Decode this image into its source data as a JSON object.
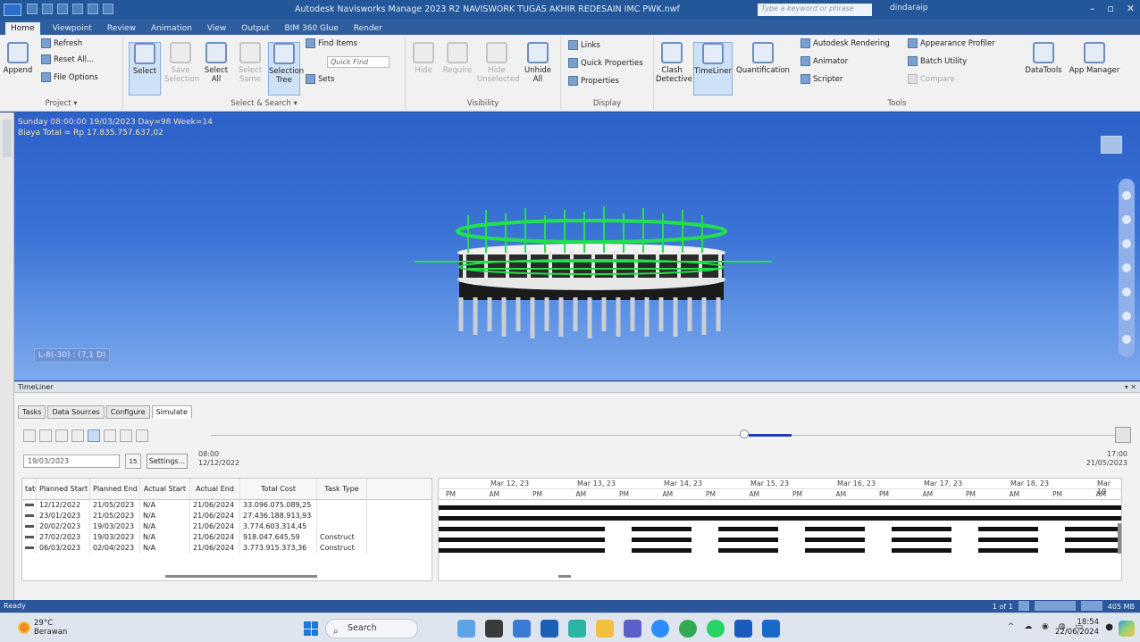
{
  "titlebar": {
    "title": "Autodesk Navisworks Manage 2023   R2 NAVISWORK TUGAS AKHIR REDESAIN IMC PWK.nwf",
    "search_placeholder": "Type a keyword or phrase",
    "user": "dindaraip",
    "accent": "#24579a"
  },
  "tabs": [
    "Home",
    "Viewpoint",
    "Review",
    "Animation",
    "View",
    "Output",
    "BIM 360 Glue",
    "Render"
  ],
  "ribbon": {
    "project": {
      "label": "Project ▾",
      "append": "Append",
      "refresh": "Refresh",
      "reset": "Reset All...",
      "file_options": "File Options"
    },
    "select_search": {
      "label": "Select & Search ▾",
      "select": "Select",
      "save_selection": "Save Selection",
      "select_all": "Select All",
      "select_same": "Select Same",
      "selection_tree": "Selection Tree",
      "find_items": "Find Items",
      "quick_find": "Quick Find",
      "sets": "Sets"
    },
    "visibility": {
      "label": "Visibility",
      "hide": "Hide",
      "require": "Require",
      "hide_unselected": "Hide Unselected",
      "unhide_all": "Unhide All"
    },
    "display": {
      "label": "Display",
      "links": "Links",
      "quick_properties": "Quick Properties",
      "properties": "Properties"
    },
    "tools": {
      "label": "Tools",
      "clash": "Clash Detective",
      "timeliner": "TimeLiner",
      "quantification": "Quantification",
      "autodesk_rendering": "Autodesk Rendering",
      "animator": "Animator",
      "scripter": "Scripter",
      "appearance_profiler": "Appearance Profiler",
      "batch_utility": "Batch Utility",
      "compare": "Compare",
      "datatools": "DataTools",
      "app_manager": "App Manager"
    }
  },
  "viewport": {
    "line1": "Sunday 08:00:00 19/03/2023 Day=98 Week=14",
    "line2": "Biaya Total = Rp 17.835.757.637,02",
    "coord": "L-8(-30) : (7,1 D)",
    "model_color": "#22e04a"
  },
  "timeliner": {
    "title": "TimeLiner",
    "tabs": [
      "Tasks",
      "Data Sources",
      "Configure",
      "Simulate"
    ],
    "date_value": "19/03/2023",
    "settings": "Settings...",
    "start_time": "08:00",
    "start_date": "12/12/2022",
    "end_time": "17:00",
    "end_date": "21/05/2023",
    "columns": [
      "tatus",
      "Planned Start",
      "Planned End",
      "Actual Start",
      "Actual End",
      "Total Cost",
      "Task Type"
    ],
    "rows": [
      [
        "12/12/2022",
        "21/05/2023",
        "N/A",
        "21/06/2024",
        "33.096.075.089,25",
        ""
      ],
      [
        "23/01/2023",
        "21/05/2023",
        "N/A",
        "21/06/2024",
        "27.436.188.913,93",
        ""
      ],
      [
        "20/02/2023",
        "19/03/2023",
        "N/A",
        "21/06/2024",
        "3.774.603.314,45",
        ""
      ],
      [
        "27/02/2023",
        "19/03/2023",
        "N/A",
        "21/06/2024",
        "918.047.645,59",
        "Construct"
      ],
      [
        "06/03/2023",
        "02/04/2023",
        "N/A",
        "21/06/2024",
        "3.773.915.373,36",
        "Construct"
      ]
    ],
    "gantt_dates": [
      "Mar 12, 23",
      "Mar 13, 23",
      "Mar 14, 23",
      "Mar 15, 23",
      "Mar 16, 23",
      "Mar 17, 23",
      "Mar 18, 23",
      "Mar 19"
    ],
    "gantt_halves": [
      "PM",
      "AM",
      "PM",
      "AM",
      "PM",
      "AM",
      "PM",
      "AM",
      "PM",
      "AM",
      "PM",
      "AM",
      "PM",
      "AM",
      "PM",
      "AM"
    ]
  },
  "statusbar": {
    "text": "Ready",
    "page": "1 of 1",
    "zoom": "405 MB"
  },
  "taskbar": {
    "temp": "29°C",
    "weather": "Berawan",
    "search": "Search",
    "time": "18:54",
    "date": "22/06/2024"
  }
}
